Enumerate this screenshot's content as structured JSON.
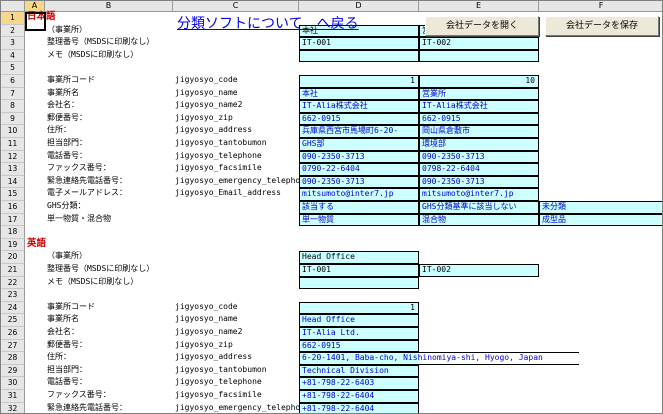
{
  "header": {
    "link_label": "分類ソフトについて　へ戻る",
    "open_button_label": "会社データを開く",
    "save_button_label": "会社データを保存"
  },
  "columns": [
    "A",
    "B",
    "C",
    "D",
    "E",
    "F"
  ],
  "rows": [
    {
      "num": "1",
      "a": "日本語",
      "b": "",
      "c": "",
      "d": "",
      "e": "",
      "f": "",
      "kind": "section"
    },
    {
      "num": "2",
      "b": "（事業所）",
      "c": "",
      "d": "本社",
      "e": "営業所",
      "f": "",
      "kind": "top"
    },
    {
      "num": "3",
      "b": "整理番号（MSDSに印刷なし）",
      "c": "",
      "d": "IT-001",
      "e": "IT-002",
      "f": "",
      "kind": "top"
    },
    {
      "num": "4",
      "b": "メモ（MSDSに印刷なし）",
      "c": "",
      "d": "",
      "e": "",
      "f": "",
      "kind": "top"
    },
    {
      "num": "5",
      "b": "",
      "c": "",
      "d": "",
      "e": "",
      "f": "",
      "kind": "blank"
    },
    {
      "num": "6",
      "b": "事業所コード",
      "c": "jigyosyo_code",
      "d": "1",
      "e": "10",
      "f": "",
      "kind": "code"
    },
    {
      "num": "7",
      "b": "事業所名",
      "c": "jigyosyo_name",
      "d": "本社",
      "e": "営業所",
      "f": "",
      "kind": "data"
    },
    {
      "num": "8",
      "b": "会社名：",
      "c": "jigyosyo_name2",
      "d": "IT-Alia株式会社",
      "e": "IT-Alia株式会社",
      "f": "",
      "kind": "data"
    },
    {
      "num": "9",
      "b": "郵便番号：",
      "c": "jigyosyo_zip",
      "d": "662-0915",
      "e": "662-0915",
      "f": "",
      "kind": "data"
    },
    {
      "num": "10",
      "b": "住所：",
      "c": "jigyosyo_address",
      "d": "兵庫県西宮市馬場町6-20-",
      "e": "岡山県倉敷市",
      "f": "",
      "kind": "data"
    },
    {
      "num": "11",
      "b": "担当部門：",
      "c": "jigyosyo_tantobumon",
      "d": "GHS部",
      "e": "環境部",
      "f": "",
      "kind": "data"
    },
    {
      "num": "12",
      "b": "電話番号：",
      "c": "jigyosyo_telephone",
      "d": "090-2350-3713",
      "e": "090-2350-3713",
      "f": "",
      "kind": "data"
    },
    {
      "num": "13",
      "b": "ファックス番号：",
      "c": "jigyosyo_facsimile",
      "d": "0790-22-6404",
      "e": "0798-22-6404",
      "f": "",
      "kind": "data"
    },
    {
      "num": "14",
      "b": "緊急連絡先電話番号：",
      "c": "jigyosyo_emergency_telephone",
      "d": "090-2350-3713",
      "e": "090-2350-3713",
      "f": "",
      "kind": "data"
    },
    {
      "num": "15",
      "b": "電子メールアドレス：",
      "c": "jigyosyo_Email_address",
      "d": "mitsumoto@inter7.jp",
      "e": "mitsumoto@inter7.jp",
      "f": "",
      "kind": "data"
    },
    {
      "num": "16",
      "b": "GHS分類：",
      "c": "",
      "d": "該当する",
      "e": "GHS分類基準に該当しない",
      "f": "未分類",
      "kind": "data3"
    },
    {
      "num": "17",
      "b": "単一物質・混合物",
      "c": "",
      "d": "単一物質",
      "e": "混合物",
      "f": "成型品",
      "kind": "data3"
    },
    {
      "num": "18",
      "b": "",
      "c": "",
      "d": "",
      "e": "",
      "f": "",
      "kind": "blank"
    },
    {
      "num": "19",
      "a": "英語",
      "b": "",
      "c": "",
      "d": "",
      "e": "",
      "f": "",
      "kind": "section"
    },
    {
      "num": "20",
      "b": "（事業所）",
      "c": "",
      "d": "Head Office",
      "e": "",
      "f": "",
      "kind": "top"
    },
    {
      "num": "21",
      "b": "整理番号（MSDSに印刷なし）",
      "c": "",
      "d": "IT-001",
      "e": "IT-002",
      "f": "",
      "kind": "top"
    },
    {
      "num": "22",
      "b": "メモ（MSDSに印刷なし）",
      "c": "",
      "d": "",
      "e": "",
      "f": "",
      "kind": "top"
    },
    {
      "num": "23",
      "b": "",
      "c": "",
      "d": "",
      "e": "",
      "f": "",
      "kind": "blank"
    },
    {
      "num": "24",
      "b": "事業所コード",
      "c": "jigyosyo_code",
      "d": "1",
      "e": "",
      "f": "",
      "kind": "code"
    },
    {
      "num": "25",
      "b": "事業所名",
      "c": "jigyosyo_name",
      "d": "Head Office",
      "e": "",
      "f": "",
      "kind": "data"
    },
    {
      "num": "26",
      "b": "会社名：",
      "c": "jigyosyo_name2",
      "d": "IT-Alia Ltd.",
      "e": "",
      "f": "",
      "kind": "data"
    },
    {
      "num": "27",
      "b": "郵便番号：",
      "c": "jigyosyo_zip",
      "d": "662-0915",
      "e": "",
      "f": "",
      "kind": "data"
    },
    {
      "num": "28",
      "b": "住所：",
      "c": "jigyosyo_address",
      "d": "6-20-1401, Baba-cho, Nishinomiya-shi, Hyogo, Japan",
      "e": "",
      "f": "",
      "kind": "overflow"
    },
    {
      "num": "29",
      "b": "担当部門：",
      "c": "jigyosyo_tantobumon",
      "d": "Technical Division",
      "e": "",
      "f": "",
      "kind": "data"
    },
    {
      "num": "30",
      "b": "電話番号：",
      "c": "jigyosyo_telephone",
      "d": "+81-798-22-6403",
      "e": "",
      "f": "",
      "kind": "data"
    },
    {
      "num": "31",
      "b": "ファックス番号：",
      "c": "jigyosyo_facsimile",
      "d": "+81-798-22-6404",
      "e": "",
      "f": "",
      "kind": "data"
    },
    {
      "num": "32",
      "b": "緊急連絡先電話番号：",
      "c": "jigyosyo_emergency_telephone",
      "d": "+81-798-22-6404",
      "e": "",
      "f": "",
      "kind": "data"
    }
  ]
}
